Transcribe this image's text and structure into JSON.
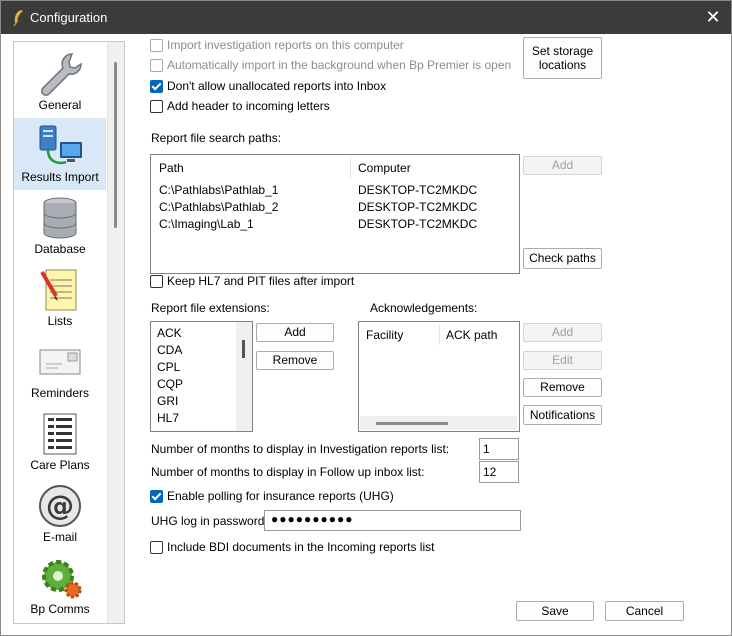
{
  "window": {
    "title": "Configuration"
  },
  "sidebar": {
    "items": [
      {
        "label": "General",
        "icon": "wrench-icon"
      },
      {
        "label": "Results Import",
        "icon": "server-network-icon"
      },
      {
        "label": "Database",
        "icon": "database-icon"
      },
      {
        "label": "Lists",
        "icon": "notepad-list-icon"
      },
      {
        "label": "Reminders",
        "icon": "envelope-icon"
      },
      {
        "label": "Care Plans",
        "icon": "document-list-icon"
      },
      {
        "label": "E-mail",
        "icon": "at-sign-icon"
      },
      {
        "label": "Bp Comms",
        "icon": "gear-cog-icon"
      }
    ],
    "selected": "Results Import"
  },
  "options": {
    "import_reports": "Import investigation reports on this computer",
    "auto_import": "Automatically import in the background when Bp Premier is open",
    "dont_allow_unallocated": "Don't allow unallocated reports into Inbox",
    "add_header": "Add header to incoming letters",
    "keep_files": "Keep HL7 and PIT files after import",
    "enable_polling": "Enable polling for insurance reports (UHG)",
    "include_bdi": "Include BDI documents in the Incoming reports list"
  },
  "buttons": {
    "set_storage": "Set storage locations",
    "add_path": "Add",
    "check_paths": "Check paths",
    "add_ext": "Add",
    "remove_ext": "Remove",
    "add_ack": "Add",
    "edit_ack": "Edit",
    "remove_ack": "Remove",
    "notifications": "Notifications",
    "save": "Save",
    "cancel": "Cancel"
  },
  "search_paths": {
    "label": "Report file search paths:",
    "columns": [
      "Path",
      "Computer"
    ],
    "rows": [
      {
        "path": "C:\\Pathlabs\\Pathlab_1",
        "computer": "DESKTOP-TC2MKDC"
      },
      {
        "path": "C:\\Pathlabs\\Pathlab_2",
        "computer": "DESKTOP-TC2MKDC"
      },
      {
        "path": "C:\\Imaging\\Lab_1",
        "computer": "DESKTOP-TC2MKDC"
      }
    ]
  },
  "extensions": {
    "label": "Report file extensions:",
    "items": [
      "ACK",
      "CDA",
      "CPL",
      "CQP",
      "GRI",
      "HL7"
    ]
  },
  "acknowledgements": {
    "label": "Acknowledgements:",
    "columns": [
      "Facility",
      "ACK path"
    ]
  },
  "settings": {
    "investigation_months_label": "Number of months to display in Investigation reports list:",
    "investigation_months": "1",
    "followup_months_label": "Number of months to display in Follow up inbox list:",
    "followup_months": "12",
    "uhg_password_label": "UHG log in password:",
    "uhg_password": "●●●●●●●●●●"
  },
  "colors": {
    "titlebar": "#3b3b3b",
    "accent": "#0067c0",
    "selected": "#d9e8f6"
  }
}
